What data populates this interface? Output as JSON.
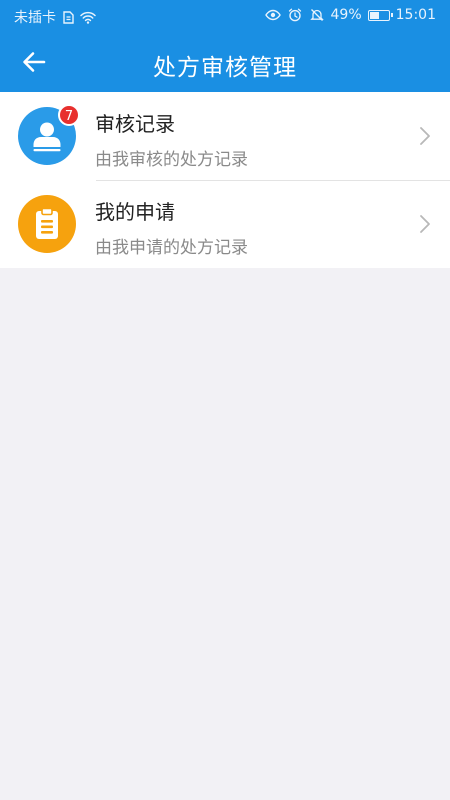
{
  "status_bar": {
    "carrier": "未插卡",
    "battery_percent": "49%",
    "time": "15:01",
    "icons": [
      "sim-icon",
      "wifi-icon",
      "eye-icon",
      "alarm-icon",
      "mute-icon",
      "battery-icon"
    ]
  },
  "header": {
    "title": "处方审核管理",
    "back_icon": "arrow-left-icon",
    "background_color": "#1a8fe3"
  },
  "menu": {
    "items": [
      {
        "title": "审核记录",
        "subtitle": "由我审核的处方记录",
        "icon": "user-icon",
        "icon_color": "#2a9be8",
        "badge": "7"
      },
      {
        "title": "我的申请",
        "subtitle": "由我申请的处方记录",
        "icon": "clipboard-icon",
        "icon_color": "#f6a20e"
      }
    ]
  },
  "colors": {
    "background": "#f2f1f5",
    "badge": "#e8302e"
  }
}
